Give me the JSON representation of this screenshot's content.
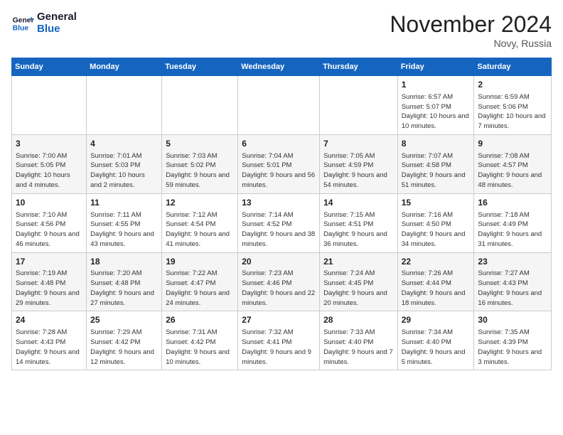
{
  "logo": {
    "line1": "General",
    "line2": "Blue"
  },
  "title": "November 2024",
  "location": "Novy, Russia",
  "days_of_week": [
    "Sunday",
    "Monday",
    "Tuesday",
    "Wednesday",
    "Thursday",
    "Friday",
    "Saturday"
  ],
  "weeks": [
    [
      {
        "day": "",
        "content": ""
      },
      {
        "day": "",
        "content": ""
      },
      {
        "day": "",
        "content": ""
      },
      {
        "day": "",
        "content": ""
      },
      {
        "day": "",
        "content": ""
      },
      {
        "day": "1",
        "content": "Sunrise: 6:57 AM\nSunset: 5:07 PM\nDaylight: 10 hours and 10 minutes."
      },
      {
        "day": "2",
        "content": "Sunrise: 6:59 AM\nSunset: 5:06 PM\nDaylight: 10 hours and 7 minutes."
      }
    ],
    [
      {
        "day": "3",
        "content": "Sunrise: 7:00 AM\nSunset: 5:05 PM\nDaylight: 10 hours and 4 minutes."
      },
      {
        "day": "4",
        "content": "Sunrise: 7:01 AM\nSunset: 5:03 PM\nDaylight: 10 hours and 2 minutes."
      },
      {
        "day": "5",
        "content": "Sunrise: 7:03 AM\nSunset: 5:02 PM\nDaylight: 9 hours and 59 minutes."
      },
      {
        "day": "6",
        "content": "Sunrise: 7:04 AM\nSunset: 5:01 PM\nDaylight: 9 hours and 56 minutes."
      },
      {
        "day": "7",
        "content": "Sunrise: 7:05 AM\nSunset: 4:59 PM\nDaylight: 9 hours and 54 minutes."
      },
      {
        "day": "8",
        "content": "Sunrise: 7:07 AM\nSunset: 4:58 PM\nDaylight: 9 hours and 51 minutes."
      },
      {
        "day": "9",
        "content": "Sunrise: 7:08 AM\nSunset: 4:57 PM\nDaylight: 9 hours and 48 minutes."
      }
    ],
    [
      {
        "day": "10",
        "content": "Sunrise: 7:10 AM\nSunset: 4:56 PM\nDaylight: 9 hours and 46 minutes."
      },
      {
        "day": "11",
        "content": "Sunrise: 7:11 AM\nSunset: 4:55 PM\nDaylight: 9 hours and 43 minutes."
      },
      {
        "day": "12",
        "content": "Sunrise: 7:12 AM\nSunset: 4:54 PM\nDaylight: 9 hours and 41 minutes."
      },
      {
        "day": "13",
        "content": "Sunrise: 7:14 AM\nSunset: 4:52 PM\nDaylight: 9 hours and 38 minutes."
      },
      {
        "day": "14",
        "content": "Sunrise: 7:15 AM\nSunset: 4:51 PM\nDaylight: 9 hours and 36 minutes."
      },
      {
        "day": "15",
        "content": "Sunrise: 7:16 AM\nSunset: 4:50 PM\nDaylight: 9 hours and 34 minutes."
      },
      {
        "day": "16",
        "content": "Sunrise: 7:18 AM\nSunset: 4:49 PM\nDaylight: 9 hours and 31 minutes."
      }
    ],
    [
      {
        "day": "17",
        "content": "Sunrise: 7:19 AM\nSunset: 4:48 PM\nDaylight: 9 hours and 29 minutes."
      },
      {
        "day": "18",
        "content": "Sunrise: 7:20 AM\nSunset: 4:48 PM\nDaylight: 9 hours and 27 minutes."
      },
      {
        "day": "19",
        "content": "Sunrise: 7:22 AM\nSunset: 4:47 PM\nDaylight: 9 hours and 24 minutes."
      },
      {
        "day": "20",
        "content": "Sunrise: 7:23 AM\nSunset: 4:46 PM\nDaylight: 9 hours and 22 minutes."
      },
      {
        "day": "21",
        "content": "Sunrise: 7:24 AM\nSunset: 4:45 PM\nDaylight: 9 hours and 20 minutes."
      },
      {
        "day": "22",
        "content": "Sunrise: 7:26 AM\nSunset: 4:44 PM\nDaylight: 9 hours and 18 minutes."
      },
      {
        "day": "23",
        "content": "Sunrise: 7:27 AM\nSunset: 4:43 PM\nDaylight: 9 hours and 16 minutes."
      }
    ],
    [
      {
        "day": "24",
        "content": "Sunrise: 7:28 AM\nSunset: 4:43 PM\nDaylight: 9 hours and 14 minutes."
      },
      {
        "day": "25",
        "content": "Sunrise: 7:29 AM\nSunset: 4:42 PM\nDaylight: 9 hours and 12 minutes."
      },
      {
        "day": "26",
        "content": "Sunrise: 7:31 AM\nSunset: 4:42 PM\nDaylight: 9 hours and 10 minutes."
      },
      {
        "day": "27",
        "content": "Sunrise: 7:32 AM\nSunset: 4:41 PM\nDaylight: 9 hours and 9 minutes."
      },
      {
        "day": "28",
        "content": "Sunrise: 7:33 AM\nSunset: 4:40 PM\nDaylight: 9 hours and 7 minutes."
      },
      {
        "day": "29",
        "content": "Sunrise: 7:34 AM\nSunset: 4:40 PM\nDaylight: 9 hours and 5 minutes."
      },
      {
        "day": "30",
        "content": "Sunrise: 7:35 AM\nSunset: 4:39 PM\nDaylight: 9 hours and 3 minutes."
      }
    ]
  ]
}
